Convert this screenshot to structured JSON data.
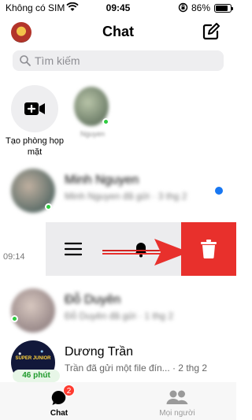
{
  "status_bar": {
    "carrier": "Không có SIM",
    "time": "09:45",
    "battery_percent": "86%",
    "battery_level": 0.86
  },
  "header": {
    "title": "Chat"
  },
  "search": {
    "placeholder": "Tìm kiếm"
  },
  "stories": {
    "new_room_label": "Tạo phòng họp mặt",
    "friend_label": "Nguyen"
  },
  "chats": [
    {
      "name": "Minh Nguyen",
      "preview": "Minh Nguyen đã gửi · 3 thg 2",
      "unread": true
    },
    {
      "time": "09:14",
      "actions": [
        "more",
        "mute",
        "delete"
      ]
    },
    {
      "name": "Đỗ Duyên",
      "preview": "Đỗ Duyên đã gửi · 1 thg 2"
    },
    {
      "name": "Dương Trần",
      "preview": "Trần đã gửi một file đín... · 2 thg 2",
      "minutes_ago": "46 phút"
    }
  ],
  "tabbar": {
    "tabs": [
      {
        "label": "Chat",
        "badge": "2",
        "active": true
      },
      {
        "label": "Mọi người",
        "active": false
      }
    ]
  },
  "colors": {
    "delete": "#e8302c",
    "unread": "#1877f2",
    "online": "#2ecc40",
    "badge": "#ff3b30"
  }
}
